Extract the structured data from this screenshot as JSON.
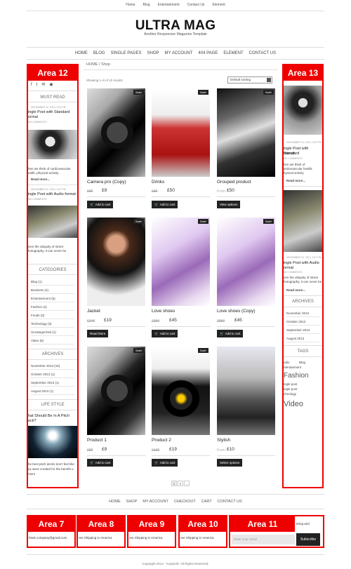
{
  "top_nav": [
    "Home",
    "Blog",
    "Entertainment",
    "Contact Us",
    "Element"
  ],
  "logo": "ULTRA MAG",
  "tagline": "Another Responsive Magazine Template",
  "main_nav": [
    "HOME",
    "BLOG",
    "SINGLE PAGES",
    "SHOP",
    "MY ACCOUNT",
    "404 PAGE",
    "ELEMENT",
    "CONTACT US"
  ],
  "left_sidebar": {
    "area_label": "Area 12",
    "must_read": "MUST READ",
    "post1_date": "NOVEMBER 22, 2013, 9:02 PM",
    "post1_title_a": "ingle Post with Standard",
    "post1_title_b": "ormat",
    "post1_comments": "NO COMMENTS",
    "post1_excerpt": "hen we think of cardiovascular",
    "post1_excerpt2": "ealth, physical activity",
    "read_more": "Read more...",
    "post2_date": "NOVEMBER 22, 2013, 9:47 PM",
    "post2_title": "ingle Post with Audio format",
    "post2_comments": "NO COMMENTS",
    "post2_excerpt": "iven the ubiquity of street",
    "post2_excerpt2": "hotography, it can never be",
    "categories_head": "CATEGORIES",
    "categories": [
      "Blog (1)",
      "Business (4)",
      "Entertainment (5)",
      "Fashion (3)",
      "Foods (3)",
      "Technology (3)",
      "Uncategorized (1)",
      "Video (5)"
    ],
    "archives_head": "ARCHIVES",
    "archives": [
      "November 2013 (15)",
      "October 2013 (1)",
      "September 2013 (1)",
      "August 2013 (1)"
    ],
    "lifestyle_head": "LIFE STYLE",
    "lifestyle_title_a": "hat Should Be In A Pitch",
    "lifestyle_title_b": "eck?",
    "lifestyle_excerpt": "he best pitch decks don't feel like",
    "lifestyle_excerpt2": "ey were created for the benefit o",
    "lifestyle_excerpt3": "nture"
  },
  "right_sidebar": {
    "area_label": "Area 13",
    "post1_date": "NOVEMBER 22, 2013, 9:02 PM",
    "post1_title_a": "ingle Post with Standard",
    "post1_title_b": "format",
    "post1_comments": "NO COMMENTS",
    "post1_excerpt": "hen we think of",
    "post1_excerpt2": "ardiovascular health,",
    "post1_excerpt3": "hysical activity",
    "read_more": "Read more...",
    "post2_date": "NOVEMBER 22, 2013, 9:47 PM",
    "post2_title_a": "ingle Post with Audio",
    "post2_title_b": "ormat",
    "post2_comments": "NO COMMENTS",
    "post2_excerpt": "ven the ubiquity of street",
    "post2_excerpt2": "hotography, it can never be",
    "archives_head": "ARCHIVES",
    "archives": [
      "November 2013",
      "October 2013",
      "September 2013",
      "August 2013"
    ],
    "tags_head": "TAGS",
    "tag_audio": "udio",
    "tag_blog": "Blog",
    "tag_entertainment": "ntertainment",
    "tag_fashion": "Fashion",
    "tag_single": "ingle post",
    "tag_single2": "ingle post",
    "tag_tech": "chnology",
    "tag_video": "Video"
  },
  "breadcrumb": "HOME / Shop",
  "results": "Showing 1–9 of 10 results",
  "sorting": "Default sorting",
  "sale_label": "Sale!",
  "products": [
    {
      "title": "Camera pro (Copy)",
      "old": "£80",
      "price": "£9",
      "button": "Add to cart",
      "sale": true
    },
    {
      "title": "Drinks",
      "old": "£80",
      "price": "£50",
      "button": "Add to cart",
      "sale": true
    },
    {
      "title": "Grouped product",
      "old": "From:",
      "price": "£50",
      "button": "View options",
      "sale": true
    },
    {
      "title": "Jacket",
      "old": "£249",
      "price": "£19",
      "button": "Read More",
      "sale": true
    },
    {
      "title": "Love shoes",
      "old": "£350",
      "price": "£45",
      "button": "Add to cart",
      "sale": true
    },
    {
      "title": "Love shoes (Copy)",
      "old": "£350",
      "price": "£45",
      "button": "Add to cart",
      "sale": true
    },
    {
      "title": "Product 1",
      "old": "£80",
      "price": "£9",
      "button": "Add to cart",
      "sale": true
    },
    {
      "title": "Product 2",
      "old": "£109",
      "price": "£19",
      "button": "Add to cart",
      "sale": true
    },
    {
      "title": "Stylish",
      "old": "From:",
      "price": "£10",
      "button": "Select options",
      "sale": false
    }
  ],
  "pagination": [
    "1",
    "2",
    "→"
  ],
  "bottom_nav": [
    "HOME",
    "SHOP",
    "MY ACCOUNT",
    "CHECKOUT",
    "CART",
    "CONTACT US"
  ],
  "footer_areas": [
    {
      "label": "Area 7",
      "text": "heek company@gmail.com"
    },
    {
      "label": "Area 8",
      "text": "ree Shipping in America"
    },
    {
      "label": "Area 9",
      "text": "ree Shipping in America"
    },
    {
      "label": "Area 10",
      "text": "ree Shipping in America"
    },
    {
      "label": "Area 11",
      "text_a": "ering and",
      "placeholder": "Enter your email",
      "button": "Subscribe"
    }
  ],
  "copyright": "Copyright 2014 - Kopasoft. All Rights Reserved.",
  "colors": {
    "accent": "#ee0000",
    "button": "#222222"
  }
}
